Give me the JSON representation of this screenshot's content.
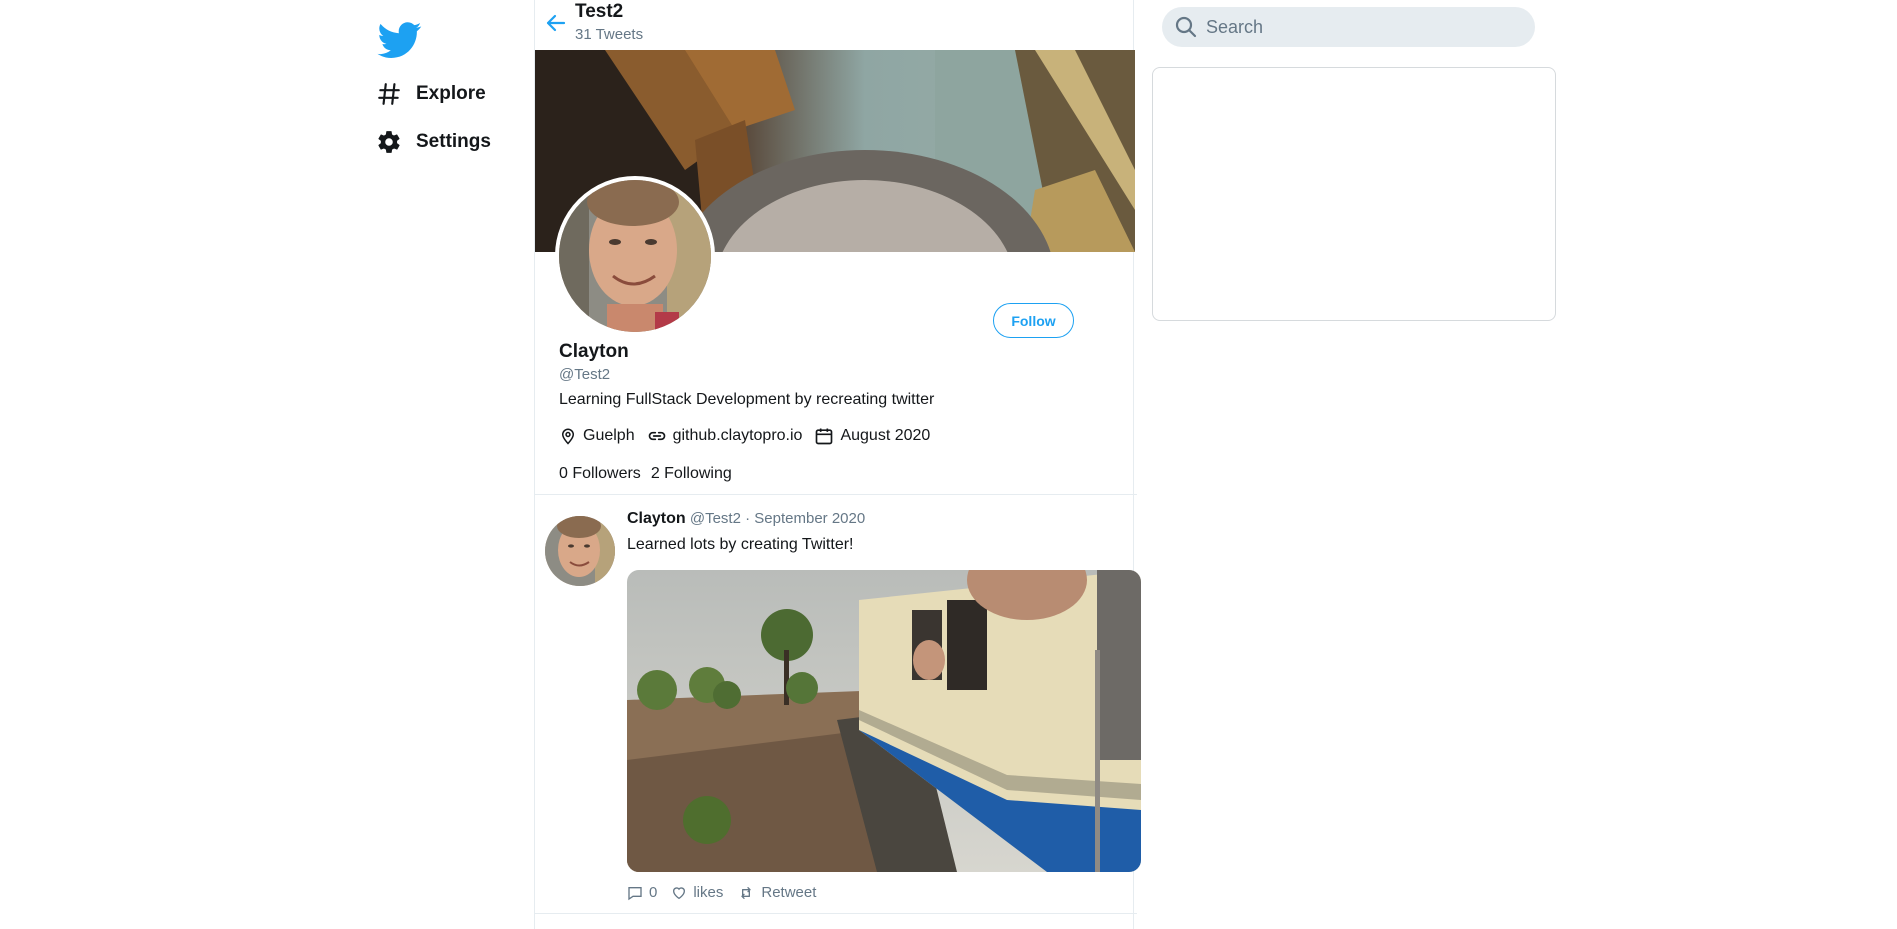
{
  "nav": {
    "logo": "twitter-bird-icon",
    "items": [
      {
        "label": "Explore",
        "icon": "hashtag-icon"
      },
      {
        "label": "Settings",
        "icon": "gear-icon"
      }
    ]
  },
  "header": {
    "title": "Test2",
    "subtitle": "31 Tweets"
  },
  "profile": {
    "name": "Clayton",
    "handle": "@Test2",
    "bio": "Learning FullStack Development by recreating twitter",
    "location": "Guelph",
    "website": "github.claytopro.io",
    "joined": "August 2020",
    "followers": "0 Followers",
    "following": "2 Following",
    "follow_label": "Follow"
  },
  "tweet": {
    "name": "Clayton",
    "handle": "@Test2",
    "separator": "·",
    "date": "September 2020",
    "text": "Learned lots by creating Twitter!",
    "reply_count": "0",
    "likes_label": "likes",
    "retweet_label": "Retweet"
  },
  "search": {
    "placeholder": "Search"
  },
  "colors": {
    "accent": "#1da1f2",
    "secondary_text": "#657786",
    "border": "#e6ecf0"
  }
}
